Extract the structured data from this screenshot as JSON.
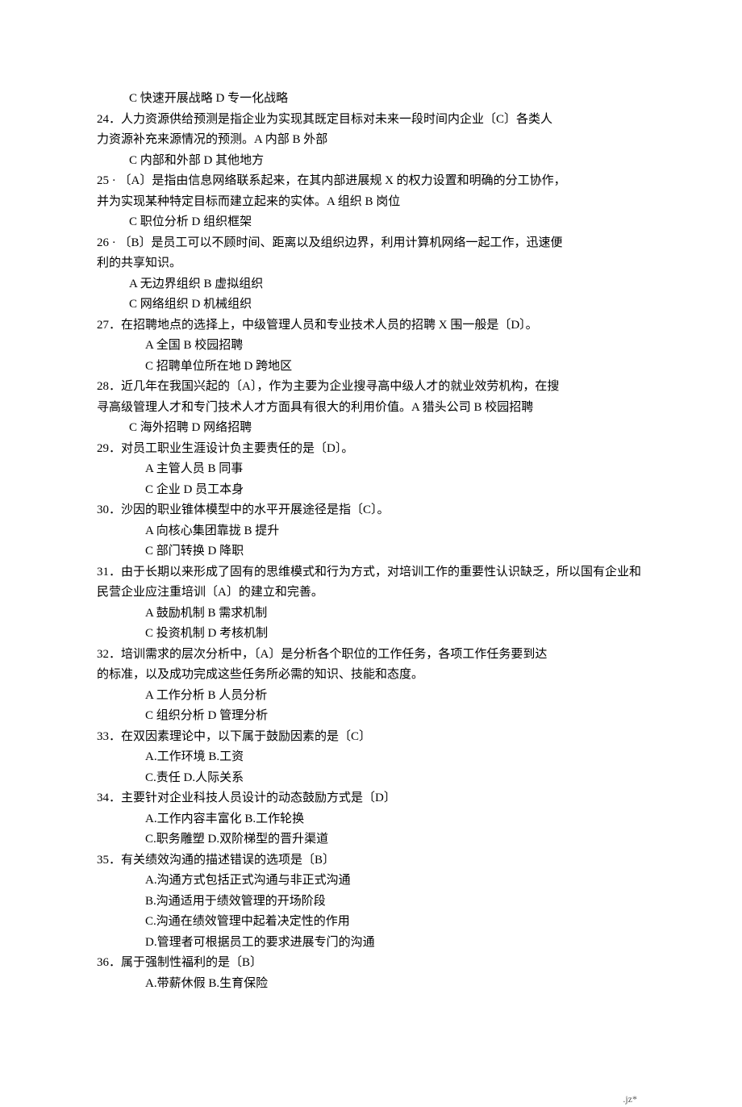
{
  "lines": [
    {
      "cls": "ind1",
      "text": "C 快速开展战略 D 专一化战略"
    },
    {
      "cls": "",
      "text": "24．人力资源供给预测是指企业为实现其既定目标对未来一段时间内企业〔C〕各类人"
    },
    {
      "cls": "",
      "text": "力资源补充来源情况的预测。A 内部 B 外部"
    },
    {
      "cls": "ind1",
      "text": "C 内部和外部 D 其他地方"
    },
    {
      "cls": "",
      "text": "25 · 〔A〕是指由信息网络联系起来，在其内部进展规 X 的权力设置和明确的分工协作，"
    },
    {
      "cls": "",
      "text": "并为实现某种特定目标而建立起来的实体。A 组织 B 岗位"
    },
    {
      "cls": "ind1",
      "text": "C 职位分析 D 组织框架"
    },
    {
      "cls": "",
      "text": "26 · 〔B〕是员工可以不顾时间、距离以及组织边界，利用计算机网络一起工作，迅速便"
    },
    {
      "cls": "",
      "text": "利的共享知识。"
    },
    {
      "cls": "ind1",
      "text": "A 无边界组织 B 虚拟组织"
    },
    {
      "cls": "ind1",
      "text": "C 网络组织 D 机械组织"
    },
    {
      "cls": "",
      "text": "27．在招聘地点的选择上，中级管理人员和专业技术人员的招聘 X 围一般是〔D〕。"
    },
    {
      "cls": "ind2",
      "text": "A 全国 B 校园招聘"
    },
    {
      "cls": "ind2",
      "text": "C 招聘单位所在地 D 跨地区"
    },
    {
      "cls": "",
      "text": "28．近几年在我国兴起的〔A〕，作为主要为企业搜寻高中级人才的就业效劳机构，在搜"
    },
    {
      "cls": "",
      "text": "寻高级管理人才和专门技术人才方面具有很大的利用价值。A 猎头公司 B 校园招聘"
    },
    {
      "cls": "ind1",
      "text": "C 海外招聘 D 网络招聘"
    },
    {
      "cls": "",
      "text": "29．对员工职业生涯设计负主要责任的是〔D〕。"
    },
    {
      "cls": "ind2",
      "text": "A 主管人员 B 同事"
    },
    {
      "cls": "ind2",
      "text": "C 企业 D 员工本身"
    },
    {
      "cls": "",
      "text": "30．沙因的职业锥体模型中的水平开展途径是指〔C〕。"
    },
    {
      "cls": "ind2",
      "text": "A 向核心集团靠拢 B 提升"
    },
    {
      "cls": "ind2",
      "text": "C 部门转换 D 降职"
    },
    {
      "cls": "",
      "text": "31．由于长期以来形成了固有的思维模式和行为方式，对培训工作的重要性认识缺乏，所以国有企业和"
    },
    {
      "cls": "",
      "text": "民营企业应注重培训〔A〕的建立和完善。"
    },
    {
      "cls": "ind2",
      "text": "A 鼓励机制 B 需求机制"
    },
    {
      "cls": "ind2",
      "text": "C 投资机制 D 考核机制"
    },
    {
      "cls": "",
      "text": "32．培训需求的层次分析中，〔A〕是分析各个职位的工作任务，各项工作任务要到达"
    },
    {
      "cls": "",
      "text": "的标准，以及成功完成这些任务所必需的知识、技能和态度。"
    },
    {
      "cls": "ind2",
      "text": "A 工作分析 B 人员分析"
    },
    {
      "cls": "ind2",
      "text": "C 组织分析 D 管理分析"
    },
    {
      "cls": "",
      "text": "33．在双因素理论中，以下属于鼓励因素的是〔C〕"
    },
    {
      "cls": "ind2",
      "text": "A.工作环境 B.工资"
    },
    {
      "cls": "ind2",
      "text": "C.责任 D.人际关系"
    },
    {
      "cls": "",
      "text": "34．主要针对企业科技人员设计的动态鼓励方式是〔D〕"
    },
    {
      "cls": "ind2",
      "text": "A.工作内容丰富化 B.工作轮换"
    },
    {
      "cls": "ind2",
      "text": "C.职务雕塑 D.双阶梯型的晋升渠道"
    },
    {
      "cls": "",
      "text": "35．有关绩效沟通的描述错误的选项是〔B〕"
    },
    {
      "cls": "ind2",
      "text": "A.沟通方式包括正式沟通与非正式沟通"
    },
    {
      "cls": "ind2",
      "text": "B.沟通适用于绩效管理的开场阶段"
    },
    {
      "cls": "ind2",
      "text": "C.沟通在绩效管理中起着决定性的作用"
    },
    {
      "cls": "ind2",
      "text": "D.管理者可根据员工的要求进展专门的沟通"
    },
    {
      "cls": "",
      "text": "36．属于强制性福利的是〔B〕"
    },
    {
      "cls": "ind2",
      "text": "A.带薪休假 B.生育保险"
    }
  ],
  "footer": ".jz*"
}
